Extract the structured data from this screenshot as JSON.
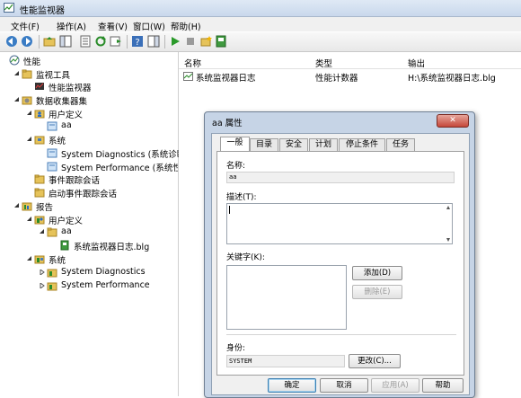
{
  "window": {
    "title": "性能监视器"
  },
  "menu": [
    "文件(F)",
    "操作(A)",
    "查看(V)",
    "窗口(W)",
    "帮助(H)"
  ],
  "toolbar": {
    "icons": [
      "back-icon",
      "forward-icon",
      "up-folder-icon",
      "show-hide-tree-icon",
      "properties-icon",
      "refresh-icon",
      "export-icon",
      "help-icon",
      "show-action-pane-icon",
      "start-icon",
      "stop-icon",
      "new-icon",
      "collector-icon"
    ]
  },
  "tree": [
    {
      "label": "性能",
      "icon": "performance-icon"
    },
    {
      "label": "监视工具",
      "icon": "folder-icon"
    },
    {
      "label": "性能监视器",
      "icon": "monitor-icon"
    },
    {
      "label": "数据收集器集",
      "icon": "gear-icon"
    },
    {
      "label": "用户定义",
      "icon": "user-folder-icon"
    },
    {
      "label": "aa",
      "icon": "collector-icon"
    },
    {
      "label": "系统",
      "icon": "system-folder-icon"
    },
    {
      "label": "System Diagnostics (系统诊断)",
      "icon": "collector-icon"
    },
    {
      "label": "System Performance (系统性能",
      "icon": "collector-icon"
    },
    {
      "label": "事件跟踪会话",
      "icon": "folder-icon"
    },
    {
      "label": "启动事件跟踪会话",
      "icon": "folder-icon"
    },
    {
      "label": "报告",
      "icon": "report-icon"
    },
    {
      "label": "用户定义",
      "icon": "user-folder-icon"
    },
    {
      "label": "aa",
      "icon": "folder-icon"
    },
    {
      "label": "系统监视器日志.blg",
      "icon": "log-icon"
    },
    {
      "label": "系统",
      "icon": "system-folder-icon"
    },
    {
      "label": "System Diagnostics",
      "icon": "folder-icon"
    },
    {
      "label": "System Performance",
      "icon": "folder-icon"
    }
  ],
  "list": {
    "columns": [
      "名称",
      "类型",
      "输出"
    ],
    "rows": [
      {
        "name": "系统监视器日志",
        "type": "性能计数器",
        "output": "H:\\系统监视器日志.blg"
      }
    ]
  },
  "dialog": {
    "title": "aa 属性",
    "close": "✕",
    "tabs": [
      "一般",
      "目录",
      "安全",
      "计划",
      "停止条件",
      "任务"
    ],
    "name_label": "名称:",
    "name_value": "aa",
    "desc_label": "描述(T):",
    "desc_value": "",
    "keywords_label": "关键字(K):",
    "add_button": "添加(D)",
    "delete_button": "删除(E)",
    "identity_label": "身份:",
    "identity_value": "SYSTEM",
    "change_button": "更改(C)...",
    "ok_button": "确定",
    "cancel_button": "取消",
    "apply_button": "应用(A)",
    "help_button": "帮助"
  }
}
